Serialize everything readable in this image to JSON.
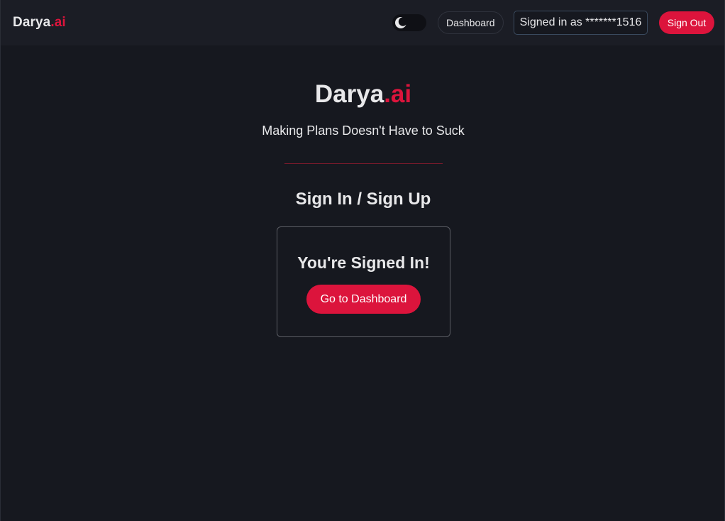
{
  "navbar": {
    "brand_main": "Darya",
    "brand_accent": ".ai",
    "theme_toggle_icon": "moon-icon",
    "dashboard_label": "Dashboard",
    "signed_in_text": "Signed in as *******1516",
    "sign_out_label": "Sign Out"
  },
  "hero": {
    "title_main": "Darya",
    "title_accent": ".ai",
    "tagline": "Making Plans Doesn't Have to Suck"
  },
  "auth": {
    "section_title": "Sign In / Sign Up",
    "card_title": "You're Signed In!",
    "cta_label": "Go to Dashboard"
  },
  "colors": {
    "accent": "#dc143c",
    "background": "#16181f",
    "navbar": "#1b1d25",
    "text": "#e8e8ea"
  }
}
